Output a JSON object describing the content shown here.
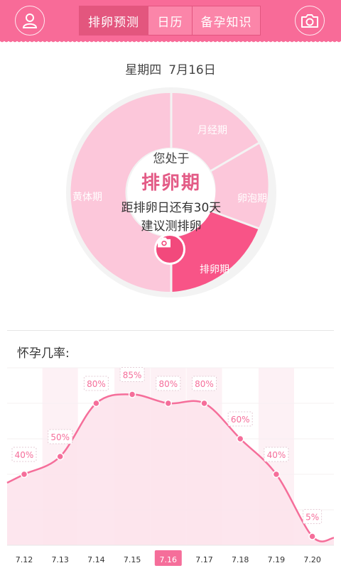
{
  "header": {
    "tabs": [
      {
        "label": "排卵预测",
        "active": true
      },
      {
        "label": "日历",
        "active": false
      },
      {
        "label": "备孕知识",
        "active": false
      }
    ],
    "left_icon": "user-icon",
    "right_icon": "camera-icon",
    "accent_color": "#f86b98"
  },
  "date": {
    "weekday": "星期四",
    "date": "7月16日"
  },
  "cycle": {
    "status_label": "您处于",
    "current_phase": "排卵期",
    "days_text": "距排卵日还有30天",
    "advice": "建议测排卵",
    "segments": [
      {
        "label": "月经期",
        "color": "#fcc7da"
      },
      {
        "label": "卵泡期",
        "color": "#fcc7da"
      },
      {
        "label": "排卵期",
        "color": "#f85487"
      },
      {
        "label": "黄体期",
        "color": "#fcc7da"
      }
    ],
    "center_icon": "camera-icon"
  },
  "chart": {
    "title": "怀孕几率:"
  },
  "chart_data": {
    "type": "area",
    "x": [
      "7.12",
      "7.13",
      "7.14",
      "7.15",
      "7.16",
      "7.17",
      "7.18",
      "7.19",
      "7.20"
    ],
    "values": [
      40,
      50,
      80,
      85,
      80,
      80,
      60,
      40,
      5
    ],
    "value_labels": [
      "40%",
      "50%",
      "80%",
      "85%",
      "80%",
      "80%",
      "60%",
      "40%",
      "5%"
    ],
    "highlight": "7.16",
    "ylim": [
      0,
      100
    ],
    "line_color": "#f56e9a",
    "fill_color": "#fde3ec"
  }
}
